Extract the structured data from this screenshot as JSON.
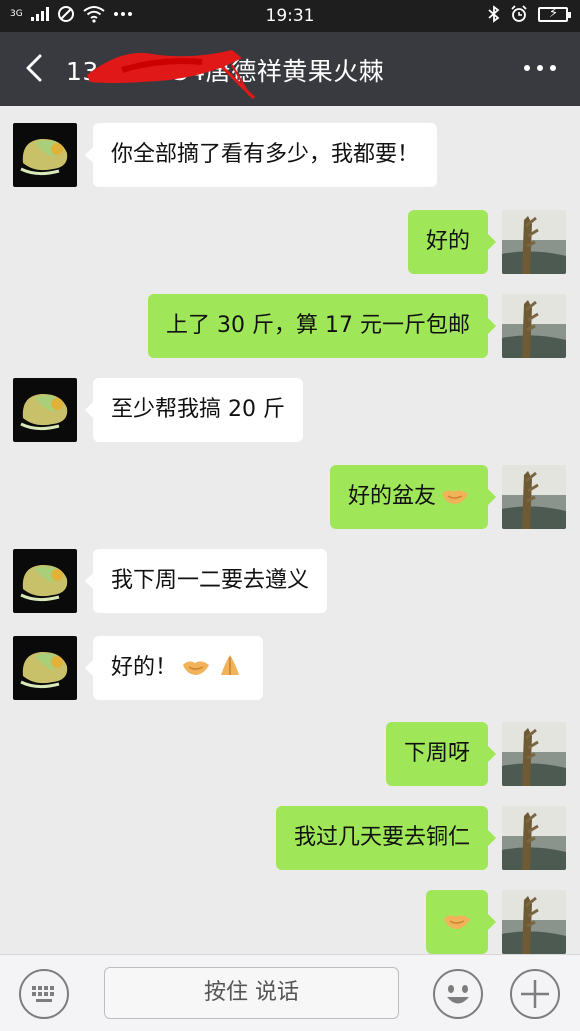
{
  "status_bar": {
    "network": "3G",
    "time": "19:31",
    "left_icons": [
      "signal-icon",
      "wifi-icon",
      "dnd-icon",
      "more-dots-icon"
    ],
    "right_icons": [
      "bluetooth-icon",
      "alarm-icon",
      "battery-icon"
    ]
  },
  "header": {
    "title": "13  521034唐德祥黄果火棘",
    "back_icon": "chevron-left-icon",
    "menu_icon": "more-horizontal-icon"
  },
  "messages": [
    {
      "side": "in",
      "text": "你全部摘了看有多少，我都要！",
      "emoji": []
    },
    {
      "side": "out",
      "text": "好的",
      "emoji": []
    },
    {
      "side": "out",
      "text": "上了 30 斤，算 17 元一斤包邮",
      "emoji": []
    },
    {
      "side": "in",
      "text": "至少帮我搞 20 斤",
      "emoji": []
    },
    {
      "side": "out",
      "text": "好的盆友",
      "emoji": [
        "handshake-emoji"
      ]
    },
    {
      "side": "in",
      "text": "我下周一二要去遵义",
      "emoji": []
    },
    {
      "side": "in",
      "text": "好的！",
      "emoji": [
        "handshake-emoji",
        "pray-emoji"
      ]
    },
    {
      "side": "out",
      "text": "下周呀",
      "emoji": []
    },
    {
      "side": "out",
      "text": "我过几天要去铜仁",
      "emoji": []
    },
    {
      "side": "out",
      "text": "",
      "emoji": [
        "handshake-emoji"
      ]
    }
  ],
  "input_bar": {
    "hold_to_talk": "按住 说话",
    "keyboard_icon": "keyboard-icon",
    "emoji_icon": "smiley-icon",
    "plus_icon": "plus-icon"
  },
  "colors": {
    "status_bar": "#1e1e1e",
    "header": "#393a3f",
    "chat_bg": "#ebebeb",
    "out_bubble": "#9fe658",
    "in_bubble": "#ffffff"
  }
}
